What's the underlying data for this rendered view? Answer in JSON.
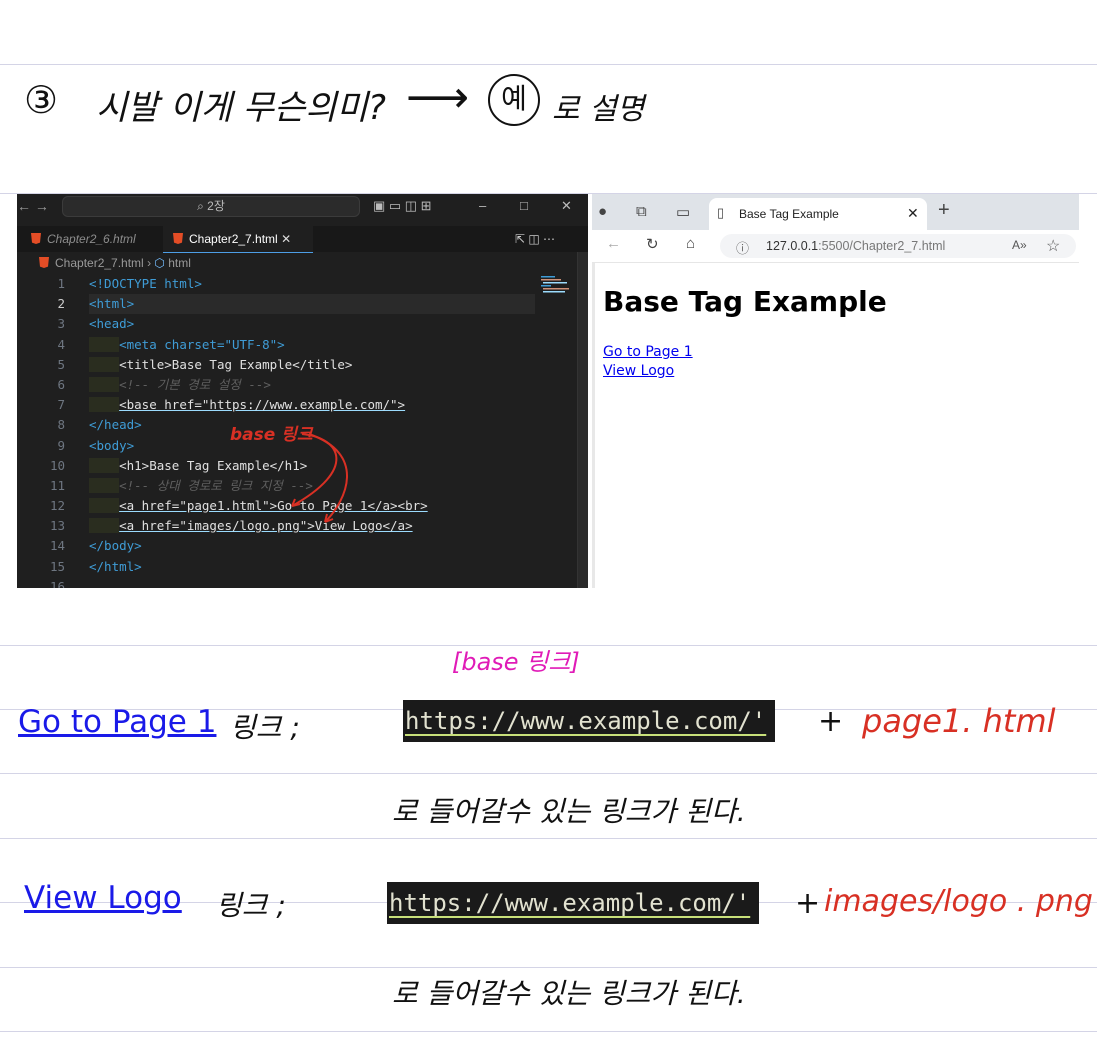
{
  "note": {
    "number": "③",
    "question": "시발 이게 무슨의미?",
    "arrow": "⟶",
    "example": "예",
    "tail": "로 설명"
  },
  "vscode": {
    "search": "⌕ 2장",
    "tabs": [
      "Chapter2_6.html",
      "Chapter2_7.html"
    ],
    "breadcrumb": [
      "Chapter2_7.html",
      "html"
    ],
    "line_numbers": [
      "1",
      "2",
      "3",
      "4",
      "5",
      "6",
      "7",
      "8",
      "9",
      "10",
      "11",
      "12",
      "13",
      "14",
      "15",
      "16"
    ]
  },
  "code_lines": [
    "<!DOCTYPE html>",
    "<html>",
    "<head>",
    "<meta charset=\"UTF-8\">",
    "<title>Base Tag Example</title>",
    "<!-- 기본 경로 설정 -->",
    "<base href=\"https://www.example.com/\">",
    "</head>",
    "<body>",
    "<h1>Base Tag Example</h1>",
    "<!-- 상대 경로로 링크 지정 -->",
    "<a href=\"page1.html\">Go to Page 1</a><br>",
    "<a href=\"images/logo.png\">View Logo</a>",
    "</body>",
    "</html>"
  ],
  "annotation_base_link": "base 링크",
  "browser": {
    "tab_title": "Base Tag Example",
    "url_host": "127.0.0.1",
    "url_rest": ":5500/Chapter2_7.html",
    "page_h1": "Base Tag Example",
    "link1": "Go to Page 1",
    "link2": "View Logo"
  },
  "explain": {
    "base_label": "[base 링크]",
    "link1": "Go to Page 1",
    "link_word1": "링크 ;",
    "base_url": "https://www.example.com/'",
    "plus": "+",
    "part1": "page1. html",
    "line1": "로 들어갈수 있는 링크가 된다.",
    "link2": "View Logo",
    "link_word2": "링크 ;",
    "part2": "images/logo . png",
    "line2": "로 들어갈수 있는 링크가 된다."
  },
  "colors": {
    "annotation_red": "#d83024",
    "annotation_pink": "#e01bb7",
    "link_blue": "#1a1ae8"
  }
}
